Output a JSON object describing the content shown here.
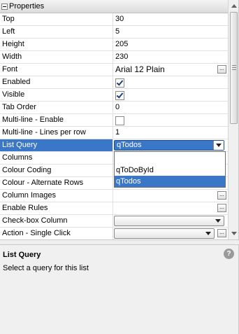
{
  "header": {
    "title": "Properties"
  },
  "rows": [
    {
      "name": "Top",
      "value": "30"
    },
    {
      "name": "Left",
      "value": "5"
    },
    {
      "name": "Height",
      "value": "205"
    },
    {
      "name": "Width",
      "value": "230"
    },
    {
      "name": "Font",
      "value": "Arial 12 Plain",
      "button": "..."
    },
    {
      "name": "Enabled",
      "checked": true
    },
    {
      "name": "Visible",
      "checked": true
    },
    {
      "name": "Tab Order",
      "value": "0"
    },
    {
      "name": "Multi-line - Enable",
      "checked": false
    },
    {
      "name": "Multi-line - Lines per row",
      "value": "1"
    },
    {
      "name": "List Query",
      "value": "qTodos"
    },
    {
      "name": "Columns",
      "value": ""
    },
    {
      "name": "Colour Coding",
      "value": ""
    },
    {
      "name": "Colour - Alternate Rows",
      "value": ""
    },
    {
      "name": "Column Images",
      "value": "",
      "button": "..."
    },
    {
      "name": "Enable Rules",
      "value": "",
      "button": "..."
    },
    {
      "name": "Check-box Column",
      "value": ""
    },
    {
      "name": "Action - Single Click",
      "value": "",
      "button": "..."
    }
  ],
  "dropdown": {
    "options": [
      "",
      "qToDoById",
      "qTodos"
    ],
    "selected": "qTodos"
  },
  "description": {
    "title": "List Query",
    "text": "Select a query for this list",
    "help_icon": "?"
  },
  "colors": {
    "selection": "#3a77c8"
  }
}
